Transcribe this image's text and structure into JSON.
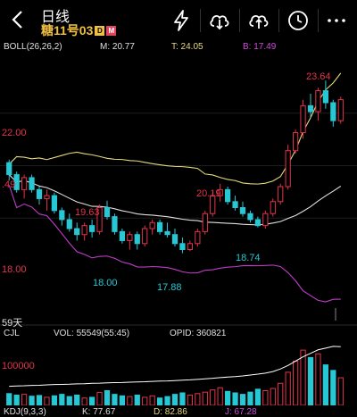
{
  "header": {
    "title": "日线",
    "symbol": "糖11号03",
    "badge_d": "D",
    "badge_m": "M"
  },
  "boll_bar": {
    "label": "BOLL(26,26,2)",
    "m": "M: 20.77",
    "t": "T: 24.05",
    "b": "B: 17.49"
  },
  "price_labels": {
    "p22": "22.00",
    "p18": "18.00",
    "left_cut": ".49"
  },
  "annotations": {
    "high": "23.64",
    "peak2": "20.19",
    "peak1": "19.63",
    "low1": "18.00",
    "low2": "17.88",
    "low3": "18.74"
  },
  "period_label": "59天",
  "cjl_bar": {
    "label": "CJL",
    "vol": "VOL: 55549(55:45)",
    "opid": "OPID: 360821"
  },
  "volume_axis": "100000",
  "kdj_bar": {
    "label": "KDJ(9,3,3)",
    "k": "K: 77.67",
    "d": "D: 82.86",
    "j": "J: 67.28"
  },
  "colors": {
    "up": "#e3344b",
    "down": "#27c7d4",
    "mid": "#e0e0e0",
    "upper": "#e6d97a",
    "lower": "#c03cc9",
    "accent": "#f0c040"
  },
  "chart_data": {
    "type": "candlestick",
    "candles": [
      [
        20.9,
        21.0,
        20.3,
        20.5
      ],
      [
        20.5,
        20.6,
        19.9,
        20.0
      ],
      [
        20.0,
        20.5,
        19.7,
        20.4
      ],
      [
        20.4,
        20.5,
        19.9,
        20.0
      ],
      [
        20.0,
        20.1,
        19.5,
        19.7
      ],
      [
        19.7,
        20.0,
        19.3,
        19.8
      ],
      [
        19.8,
        19.9,
        19.2,
        19.3
      ],
      [
        19.3,
        19.4,
        18.8,
        19.0
      ],
      [
        19.0,
        19.2,
        18.6,
        18.7
      ],
      [
        18.7,
        18.9,
        18.3,
        18.5
      ],
      [
        18.5,
        18.9,
        18.3,
        18.8
      ],
      [
        18.8,
        19.0,
        18.4,
        18.6
      ],
      [
        18.6,
        19.5,
        18.5,
        19.4
      ],
      [
        19.4,
        19.63,
        19.0,
        19.1
      ],
      [
        19.1,
        19.2,
        18.5,
        18.6
      ],
      [
        18.6,
        18.7,
        18.2,
        18.3
      ],
      [
        18.3,
        18.6,
        18.0,
        18.5
      ],
      [
        18.5,
        18.6,
        18.0,
        18.2
      ],
      [
        18.2,
        18.8,
        18.1,
        18.7
      ],
      [
        18.7,
        19.0,
        18.5,
        18.9
      ],
      [
        18.9,
        19.0,
        18.5,
        18.6
      ],
      [
        18.6,
        18.9,
        18.4,
        18.5
      ],
      [
        18.5,
        18.7,
        18.1,
        18.2
      ],
      [
        18.2,
        18.4,
        17.88,
        18.0
      ],
      [
        18.0,
        18.3,
        17.95,
        18.2
      ],
      [
        18.2,
        18.7,
        18.1,
        18.6
      ],
      [
        18.6,
        19.3,
        18.5,
        19.2
      ],
      [
        19.2,
        19.9,
        19.1,
        19.8
      ],
      [
        19.8,
        20.19,
        19.6,
        20.0
      ],
      [
        20.0,
        20.1,
        19.5,
        19.6
      ],
      [
        19.6,
        19.8,
        19.3,
        19.4
      ],
      [
        19.4,
        19.6,
        19.1,
        19.2
      ],
      [
        19.2,
        19.3,
        18.9,
        19.0
      ],
      [
        19.0,
        19.1,
        18.74,
        18.8
      ],
      [
        18.8,
        19.3,
        18.7,
        19.2
      ],
      [
        19.2,
        19.7,
        19.1,
        19.6
      ],
      [
        19.6,
        20.2,
        19.5,
        20.1
      ],
      [
        20.1,
        21.5,
        20.0,
        21.3
      ],
      [
        21.3,
        22.0,
        21.2,
        21.9
      ],
      [
        21.9,
        23.0,
        21.7,
        22.8
      ],
      [
        22.8,
        23.2,
        22.4,
        22.6
      ],
      [
        22.6,
        23.4,
        22.3,
        23.3
      ],
      [
        23.3,
        23.64,
        22.7,
        22.9
      ],
      [
        22.9,
        23.0,
        22.1,
        22.3
      ],
      [
        22.3,
        23.1,
        22.2,
        23.0
      ]
    ],
    "volumes": [
      32000,
      28000,
      30000,
      25000,
      27000,
      22000,
      26000,
      30000,
      24000,
      28000,
      20000,
      22000,
      35000,
      40000,
      30000,
      26000,
      24000,
      28000,
      22000,
      26000,
      20000,
      24000,
      30000,
      34000,
      28000,
      32000,
      36000,
      42000,
      48000,
      38000,
      34000,
      30000,
      36000,
      44000,
      40000,
      46000,
      60000,
      90000,
      120000,
      150000,
      130000,
      140000,
      110000,
      95000,
      75000
    ],
    "opid": [
      110000,
      112000,
      113000,
      115000,
      116000,
      118000,
      120000,
      121000,
      122000,
      124000,
      125000,
      127000,
      128000,
      130000,
      131000,
      132000,
      134000,
      135000,
      136000,
      138000,
      140000,
      141000,
      143000,
      145000,
      147000,
      150000,
      153000,
      156000,
      160000,
      163000,
      166000,
      170000,
      175000,
      180000,
      186000,
      195000,
      210000,
      230000,
      255000,
      280000,
      300000,
      320000,
      330000,
      340000,
      338000
    ],
    "ylim": [
      17.3,
      24.3
    ]
  }
}
